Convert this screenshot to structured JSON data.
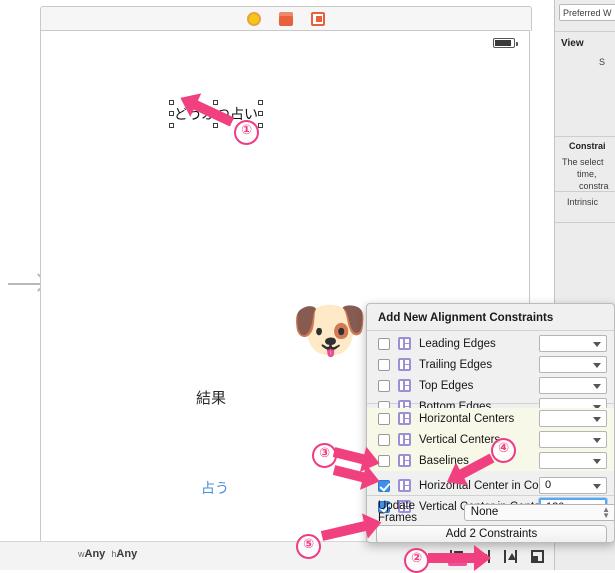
{
  "app": {
    "name": "Xcode Interface Builder"
  },
  "canvas": {
    "scene_dock_icons": [
      "view-controller-icon",
      "first-responder-icon",
      "exit-icon"
    ],
    "status_bar": {
      "battery_icon": "battery-icon"
    },
    "initial_vc_arrow": "initial-view-controller-arrow",
    "title_label": "どうぶつ占い",
    "dog_emoji": "🐶",
    "result_label": "結果",
    "fortune_button": "占う",
    "size_class": {
      "width_prefix": "w",
      "width_value": "Any",
      "height_prefix": "h",
      "height_value": "Any"
    }
  },
  "ib_toolbar": {
    "items": [
      {
        "name": "align-button",
        "icon": "align-icon",
        "active": true
      },
      {
        "name": "pin-button",
        "icon": "pin-icon",
        "active": false
      },
      {
        "name": "resolve-auto-layout-issues-button",
        "icon": "resolve-icon",
        "active": false
      },
      {
        "name": "embed-in-button",
        "icon": "embed-icon",
        "active": false
      },
      {
        "name": "editor-layout-button",
        "icon": "grid-icon",
        "active": false
      },
      {
        "name": "assistant-editor-button",
        "icon": "assistant-circle-icon",
        "active": false
      }
    ]
  },
  "inspector": {
    "preferred_width_label": "Preferred W",
    "view_section_title": "View",
    "view_s_label": "S",
    "constraints_title": "Constrai",
    "constraints_line1": "The select",
    "constraints_line2": "time,",
    "constraints_line3": "constra",
    "intrinsic_label": "Intrinsic "
  },
  "popover": {
    "title": "Add New Alignment Constraints",
    "rows": [
      {
        "label": "Leading Edges",
        "checked": false,
        "value": "",
        "icon": "align-leading-edges-icon",
        "highlight": false
      },
      {
        "label": "Trailing Edges",
        "checked": false,
        "value": "",
        "icon": "align-trailing-edges-icon",
        "highlight": false
      },
      {
        "label": "Top Edges",
        "checked": false,
        "value": "",
        "icon": "align-top-edges-icon",
        "highlight": false
      },
      {
        "label": "Bottom Edges",
        "checked": false,
        "value": "",
        "icon": "align-bottom-edges-icon",
        "highlight": false
      },
      {
        "label": "Horizontal Centers",
        "checked": false,
        "value": "",
        "icon": "align-horizontal-centers-icon",
        "highlight": true
      },
      {
        "label": "Vertical Centers",
        "checked": false,
        "value": "",
        "icon": "align-vertical-centers-icon",
        "highlight": true
      },
      {
        "label": "Baselines",
        "checked": false,
        "value": "",
        "icon": "align-baselines-icon",
        "highlight": true
      },
      {
        "label": "Horizontal Center in Contain",
        "checked": true,
        "value": "0",
        "icon": "horizontal-center-in-container-icon",
        "highlight": false
      },
      {
        "label": "Vertical Center in Container",
        "checked": true,
        "value": "120",
        "icon": "vertical-center-in-container-icon",
        "highlight": false,
        "selected": true
      }
    ],
    "update_frames_label": "Update Frames",
    "update_frames_value": "None",
    "add_button_label": "Add 2 Constraints"
  },
  "annotations": {
    "markers": [
      {
        "id": "1",
        "text": "①"
      },
      {
        "id": "2",
        "text": "②"
      },
      {
        "id": "3",
        "text": "③"
      },
      {
        "id": "4",
        "text": "④"
      },
      {
        "id": "5",
        "text": "⑤"
      }
    ],
    "accent_color": "#f0407f"
  }
}
